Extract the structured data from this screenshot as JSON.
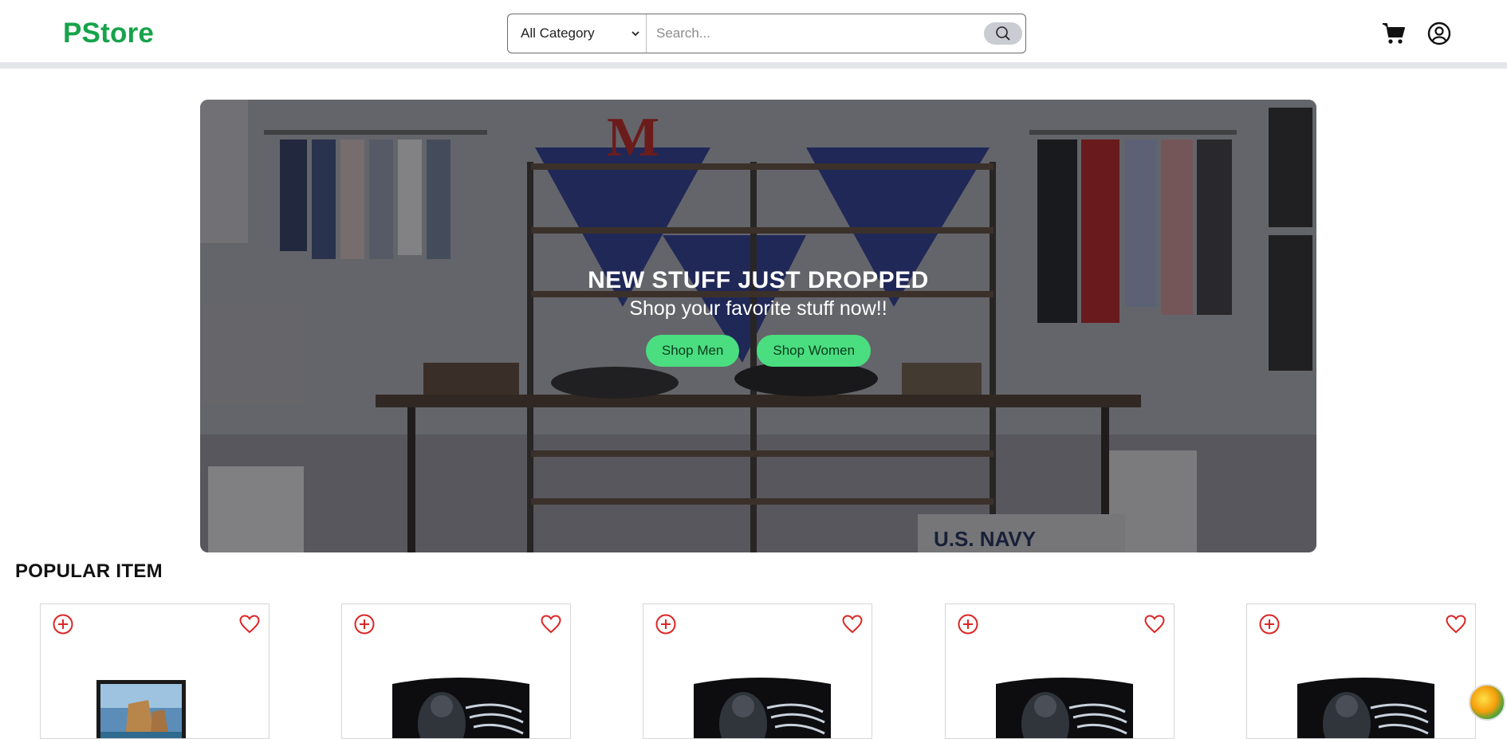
{
  "header": {
    "logo": "PStore",
    "category_selected": "All Category",
    "search_placeholder": "Search...",
    "icons": {
      "search": "search-icon",
      "cart": "cart-icon",
      "account": "account-icon"
    }
  },
  "hero": {
    "title": "NEW STUFF JUST DROPPED",
    "subtitle": "Shop your favorite stuff now!!",
    "buttons": {
      "men": "Shop Men",
      "women": "Shop Women"
    }
  },
  "popular": {
    "title": "POPULAR ITEM",
    "items": [
      {
        "image": "monitor-landscape",
        "add_icon": "plus-circle-icon",
        "fav_icon": "heart-icon"
      },
      {
        "image": "qled-gaming-monitor",
        "add_icon": "plus-circle-icon",
        "fav_icon": "heart-icon"
      },
      {
        "image": "qled-gaming-monitor",
        "add_icon": "plus-circle-icon",
        "fav_icon": "heart-icon"
      },
      {
        "image": "qled-gaming-monitor",
        "add_icon": "plus-circle-icon",
        "fav_icon": "heart-icon"
      },
      {
        "image": "qled-gaming-monitor",
        "add_icon": "plus-circle-icon",
        "fav_icon": "heart-icon"
      }
    ]
  },
  "colors": {
    "brand": "#16a34a",
    "button": "#4ade80",
    "icon_red": "#dc2626"
  }
}
